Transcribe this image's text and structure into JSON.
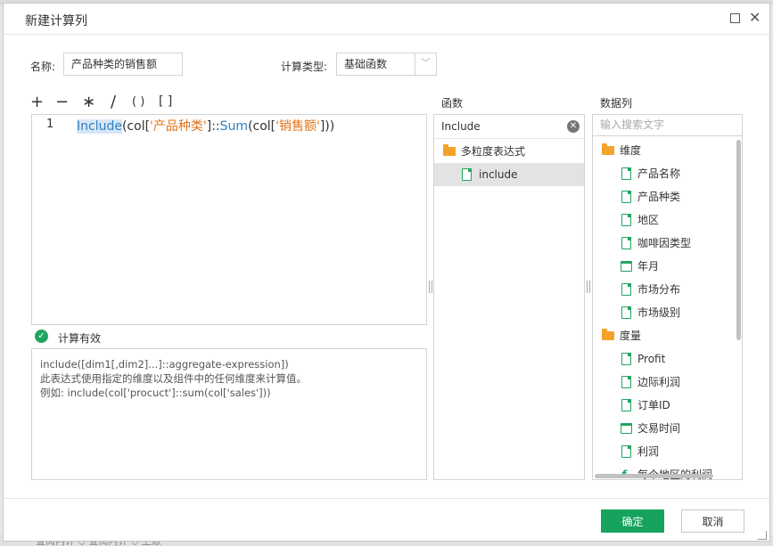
{
  "dialog": {
    "title": "新建计算列"
  },
  "form": {
    "name_label": "名称:",
    "name_value": "产品种类的销售额",
    "type_label": "计算类型:",
    "type_value": "基础函数"
  },
  "operators": [
    "+",
    "−",
    "∗",
    "/",
    "( )",
    "[ ]"
  ],
  "editor": {
    "line_number": "1",
    "tokens": {
      "t1": "Include",
      "t2": "(col[",
      "t3": "'产品种类'",
      "t4": "]::",
      "t5": "Sum",
      "t6": "(col[",
      "t7": "'销售额'",
      "t8": "]))"
    }
  },
  "validation": {
    "text": "计算有效"
  },
  "description": {
    "line1": "include([dim1[,dim2]...]::aggregate-expression])",
    "line2": "此表达式使用指定的维度以及组件中的任何维度来计算值。",
    "line3": "例如: include(col['procuct']::sum(col['sales']))"
  },
  "functions_panel": {
    "title": "函数",
    "search_value": "Include",
    "folder": "多粒度表达式",
    "item": "include"
  },
  "columns_panel": {
    "title": "数据列",
    "search_placeholder": "输入搜索文字",
    "dimensions_folder": "维度",
    "dimensions": [
      "产品名称",
      "产品种类",
      "地区",
      "咖啡因类型",
      "年月",
      "市场分布",
      "市场级别"
    ],
    "measures_folder": "度量",
    "measures": [
      "Profit",
      "边际利润",
      "订单ID",
      "交易时间",
      "利润",
      "每个地区的利润"
    ]
  },
  "footer": {
    "ok_label": "确定",
    "cancel_label": "取消"
  },
  "background": {
    "bottom_text": "查阅内计  ◇  查阅内计  ◇  上账"
  },
  "colors": {
    "accent": "#17a35e",
    "function_token": "#2d7fc1",
    "string_token": "#e0741b",
    "folder": "#f3a32a"
  }
}
